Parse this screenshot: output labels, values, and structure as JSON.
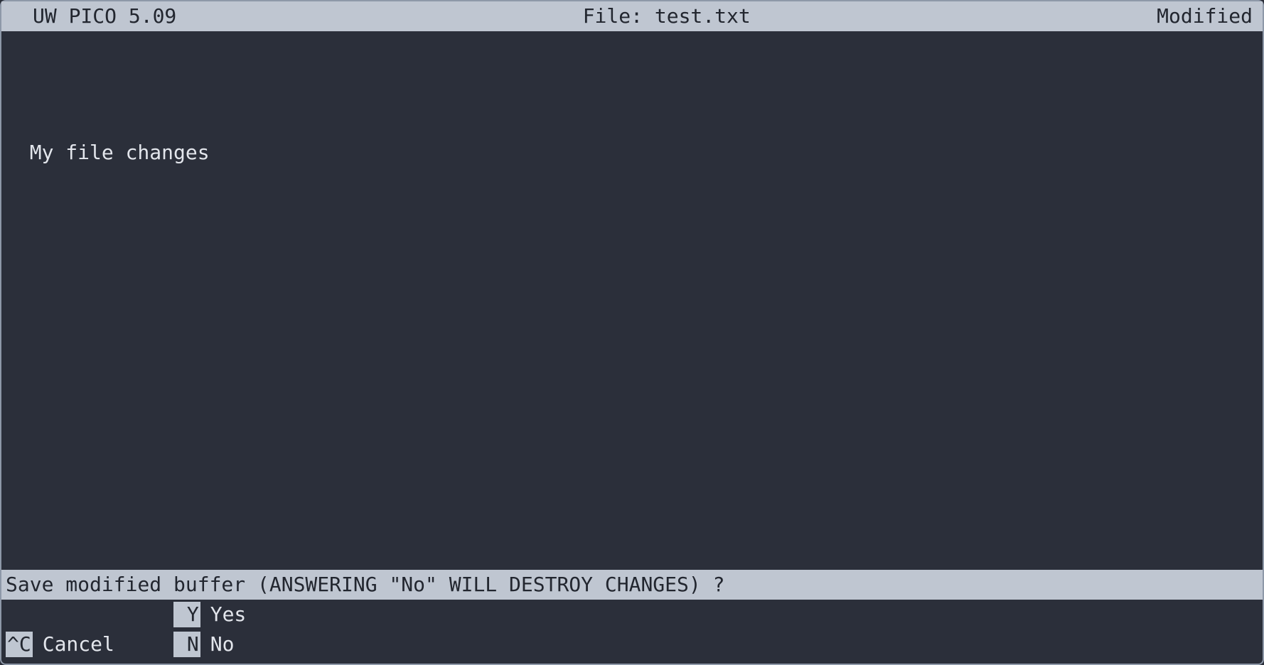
{
  "title_bar": {
    "app": "UW PICO 5.09",
    "file_label": "File: test.txt",
    "status": "Modified"
  },
  "editor": {
    "content": "My file changes"
  },
  "prompt": {
    "text": "Save modified buffer (ANSWERING \"No\" WILL DESTROY CHANGES) ?"
  },
  "options": {
    "yes": {
      "key": " Y",
      "label": "Yes"
    },
    "no": {
      "key": " N",
      "label": "No"
    },
    "cancel": {
      "key": "^C",
      "label": "Cancel"
    }
  }
}
